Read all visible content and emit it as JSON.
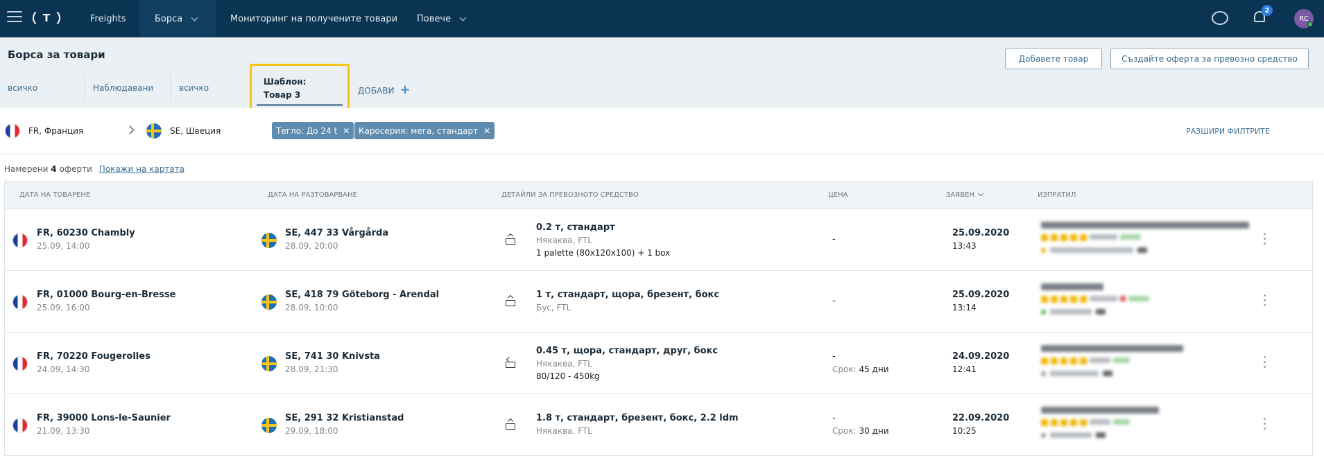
{
  "nav": {
    "items": [
      {
        "label": "Freights"
      },
      {
        "label": "Борса"
      },
      {
        "label": "Мониторинг на получените товари"
      },
      {
        "label": "Повече"
      }
    ],
    "notifications_count": "2",
    "avatar_initials": "RC"
  },
  "header": {
    "title": "Борса за товари",
    "add_cargo_label": "Добавете товар",
    "create_offer_label": "Създайте оферта за превозно средство"
  },
  "tabs": {
    "all1": "всичко",
    "watched": "Наблюдавани",
    "all2": "всичко",
    "template_line1": "Шаблон:",
    "template_line2": "Товар 3",
    "add": "ДОБАВИ"
  },
  "filters": {
    "from": "FR, Франция",
    "to": "SE, Швеция",
    "chips": [
      {
        "label": "Тегло: До 24 t"
      },
      {
        "label": "Каросерия: мега, стандарт"
      }
    ],
    "expand": "РАЗШИРИ ФИЛТРИТЕ"
  },
  "results": {
    "prefix": "Намерени",
    "count": "4",
    "suffix": "оферти",
    "map_link": "Покажи на картата"
  },
  "table": {
    "headers": {
      "load_date": "ДАТА НА ТОВАРЕНЕ",
      "unload_date": "ДАТА НА РАЗТОВАРВАНЕ",
      "vehicle": "ДЕТАЙЛИ ЗА ПРЕВОЗНОТО СРЕДСТВО",
      "price": "ЦЕНА",
      "posted": "ЗАЯВЕН",
      "sender": "ИЗПРАТИЛ"
    },
    "rows": [
      {
        "from_place": "FR, 60230 Chambly",
        "from_date": "25.09, 14:00",
        "to_place": "SE, 447 33 Vårgårda",
        "to_date": "28.09, 20:00",
        "vehicle": "0.2 т, стандарт",
        "vehicle_sub": "Някаква, FTL",
        "vehicle_extra": "1 palette (80x120x100) + 1 box",
        "price": "-",
        "term_label": "",
        "term_value": "",
        "posted_date": "25.09.2020",
        "posted_time": "13:43"
      },
      {
        "from_place": "FR, 01000 Bourg-en-Bresse",
        "from_date": "25.09, 16:00",
        "to_place": "SE, 418 79 Göteborg - Arendal",
        "to_date": "28.09, 10:00",
        "vehicle": "1 т, стандарт, щора, брезент, бокс",
        "vehicle_sub": "Бус, FTL",
        "vehicle_extra": "",
        "price": "-",
        "term_label": "",
        "term_value": "",
        "posted_date": "25.09.2020",
        "posted_time": "13:14"
      },
      {
        "from_place": "FR, 70220 Fougerolles",
        "from_date": "24.09, 14:30",
        "to_place": "SE, 741 30 Knivsta",
        "to_date": "28.09, 21:30",
        "vehicle": "0.45 т, щора, стандарт, друг, бокс",
        "vehicle_sub": "Някаква, FTL",
        "vehicle_extra": "80/120 - 450kg",
        "price": "-",
        "term_label": "Срок:",
        "term_value": "45 дни",
        "posted_date": "24.09.2020",
        "posted_time": "12:41"
      },
      {
        "from_place": "FR, 39000 Lons-le-Saunier",
        "from_date": "21.09, 13:30",
        "to_place": "SE, 291 32 Kristianstad",
        "to_date": "29.09, 18:00",
        "vehicle": "1.8 т, стандарт, брезент, бокс, 2.2 ldm",
        "vehicle_sub": "Някаква, FTL",
        "vehicle_extra": "",
        "price": "-",
        "term_label": "Срок:",
        "term_value": "30 дни",
        "posted_date": "22.09.2020",
        "posted_time": "10:25"
      }
    ]
  }
}
